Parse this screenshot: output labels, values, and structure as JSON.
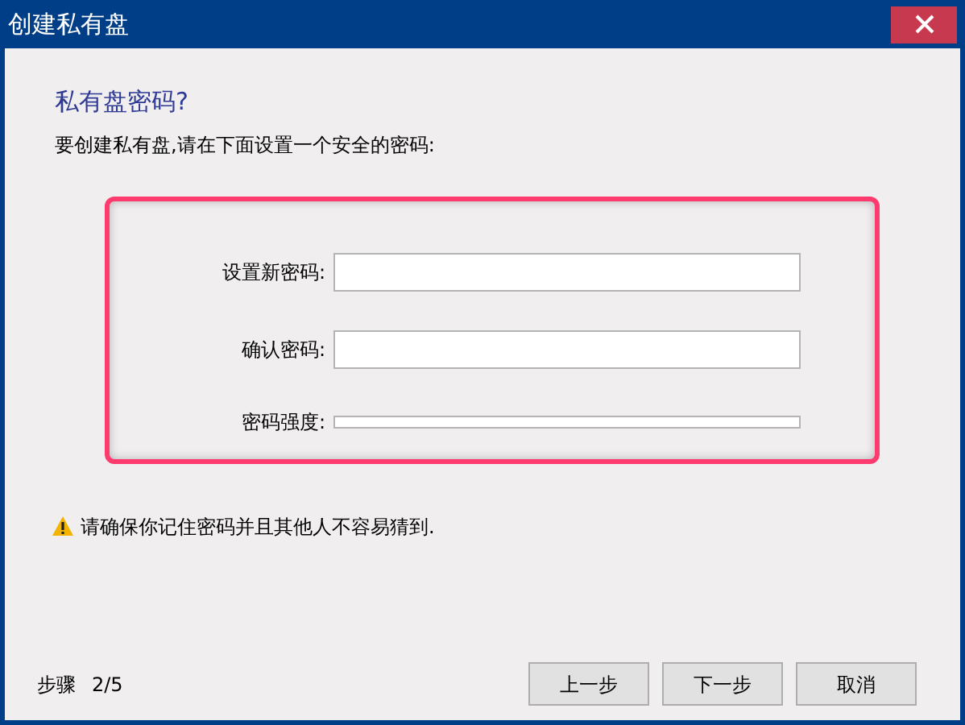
{
  "window": {
    "title": "创建私有盘"
  },
  "heading": "私有盘密码?",
  "description": "要创建私有盘,请在下面设置一个安全的密码:",
  "fields": [
    {
      "label": "设置新密码:"
    },
    {
      "label": "确认密码:"
    }
  ],
  "strength": {
    "label": "密码强度:",
    "level": 0
  },
  "warning": "请确保你记住密码并且其他人不容易猜到.",
  "step": {
    "label": "步骤",
    "value": "2/5"
  },
  "buttons": [
    "上一步",
    "下一步",
    "取消"
  ]
}
